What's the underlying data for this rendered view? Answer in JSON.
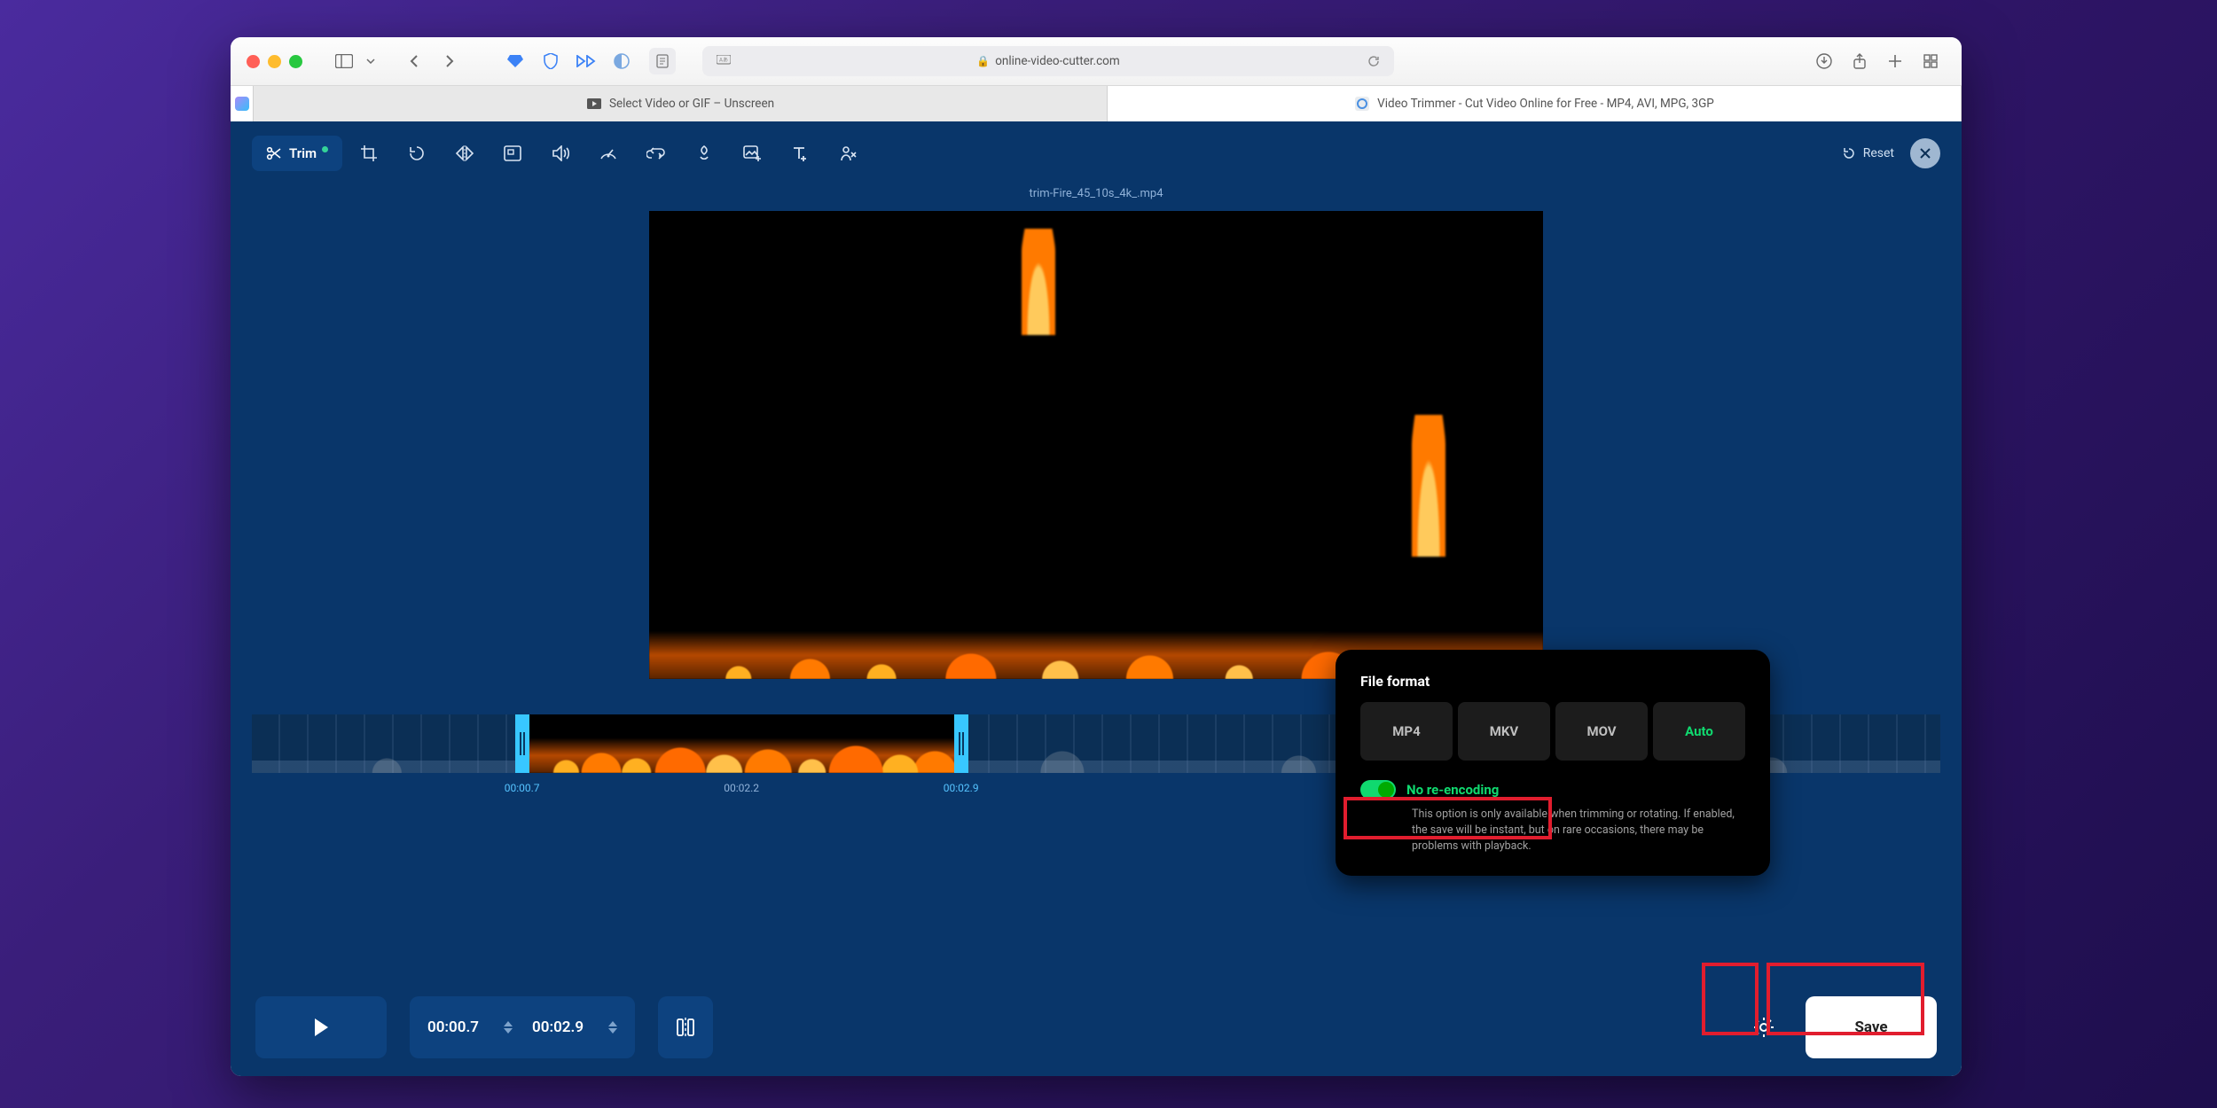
{
  "browser": {
    "url": "online-video-cutter.com",
    "tab1": "Select Video or GIF – Unscreen",
    "tab2": "Video Trimmer - Cut Video Online for Free - MP4, AVI, MPG, 3GP"
  },
  "toolbar": {
    "trim_label": "Trim",
    "reset_label": "Reset"
  },
  "filename": "trim-Fire_45_10s_4k_.mp4",
  "timeline": {
    "playhead_label": "00:02.9",
    "start_label": "00:00.7",
    "mid_label": "00:02.2",
    "end_label": "00:02.9",
    "start_pct": 16,
    "end_pct": 42
  },
  "controls": {
    "time_start": "00:00.7",
    "time_end": "00:02.9",
    "save_label": "Save"
  },
  "popover": {
    "title": "File format",
    "formats": [
      "MP4",
      "MKV",
      "MOV",
      "Auto"
    ],
    "active_format": 3,
    "toggle_label": "No re-encoding",
    "description": "This option is only available when trimming or rotating. If enabled, the save will be instant, but on rare occasions, there may be problems with playback."
  }
}
